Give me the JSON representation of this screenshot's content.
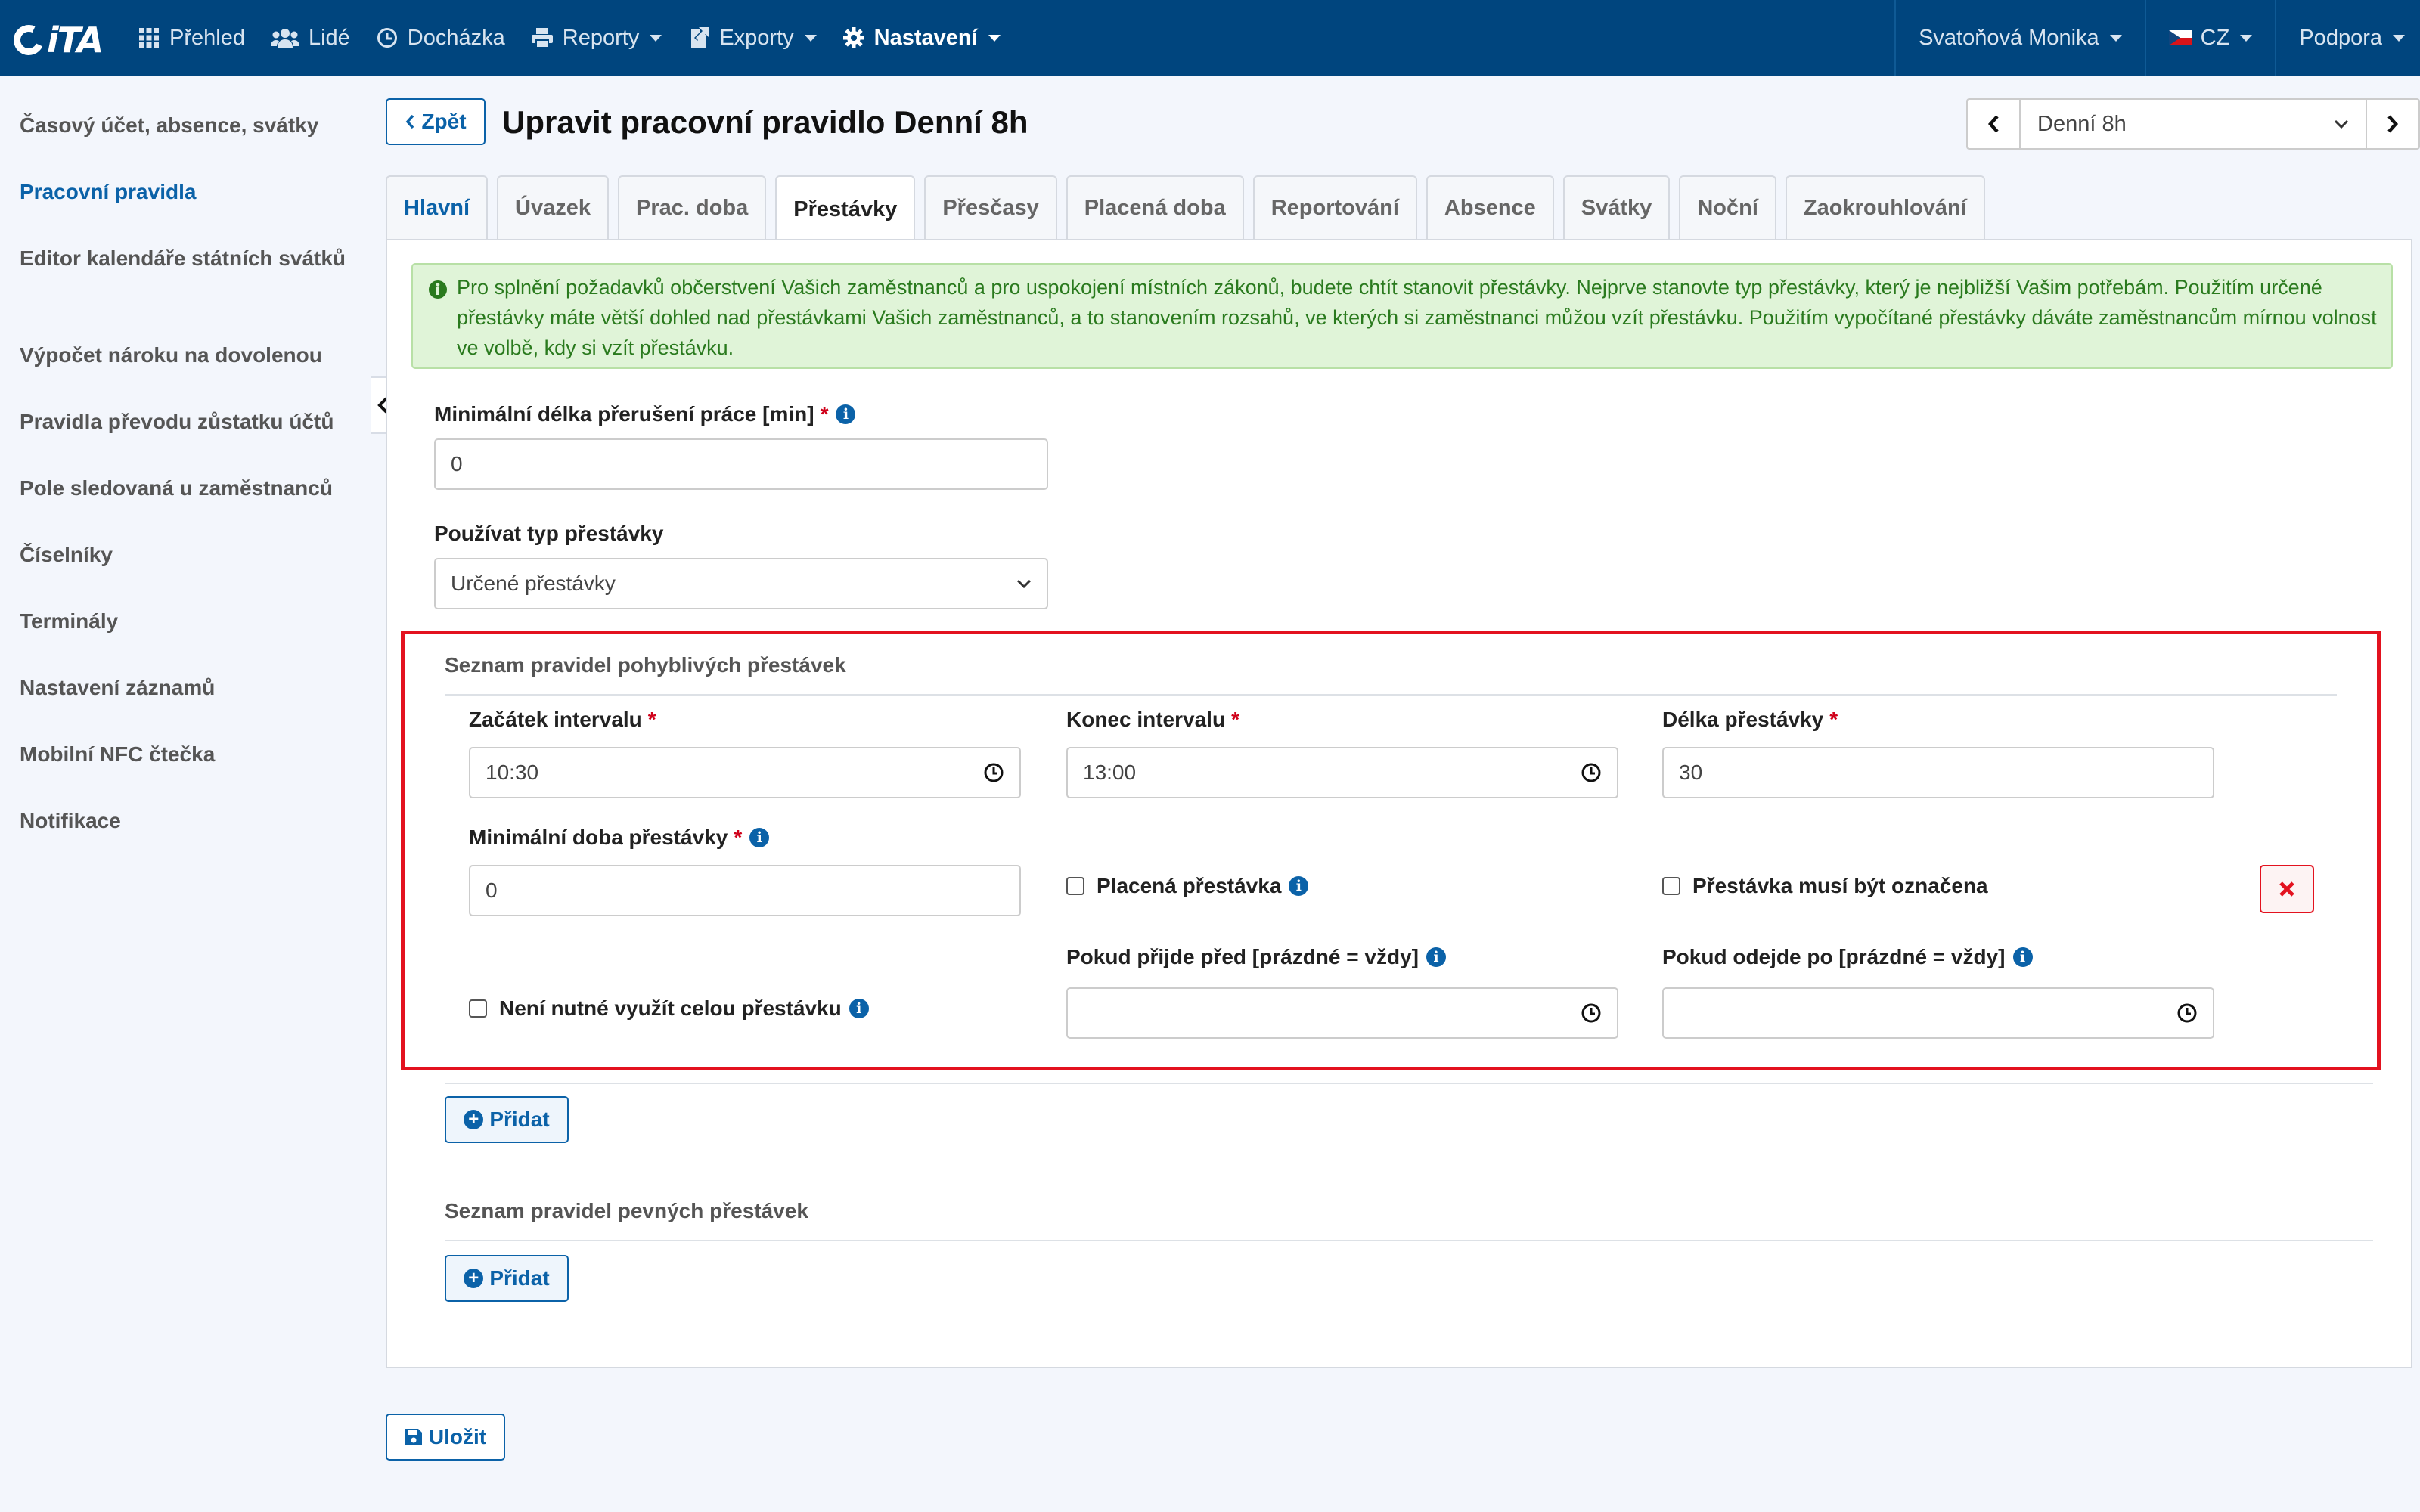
{
  "app": {
    "logo": "iTA"
  },
  "nav": {
    "items": [
      {
        "label": "Přehled",
        "icon": "grid-icon"
      },
      {
        "label": "Lidé",
        "icon": "users-icon"
      },
      {
        "label": "Docházka",
        "icon": "clock-icon"
      },
      {
        "label": "Reporty",
        "icon": "print-icon"
      },
      {
        "label": "Exporty",
        "icon": "export-icon"
      },
      {
        "label": "Nastavení",
        "icon": "gear-icon"
      }
    ],
    "user": "Svatoňová Monika",
    "language": "CZ",
    "support": "Podpora"
  },
  "sidebar": {
    "items": [
      {
        "label": "Časový účet, absence, svátky"
      },
      {
        "label": "Pracovní pravidla",
        "active": true
      },
      {
        "label": "Editor kalendáře státních svátků"
      },
      {
        "label": "Výpočet nároku na dovolenou"
      },
      {
        "label": "Pravidla převodu zůstatku účtů"
      },
      {
        "label": "Pole sledovaná u zaměstnanců"
      },
      {
        "label": "Číselníky"
      },
      {
        "label": "Terminály"
      },
      {
        "label": "Nastavení záznamů"
      },
      {
        "label": "Mobilní NFC čtečka"
      },
      {
        "label": "Notifikace"
      }
    ]
  },
  "header": {
    "back_label": "Zpět",
    "title": "Upravit pracovní pravidlo Denní 8h",
    "rule_select": "Denní 8h"
  },
  "tabs": [
    {
      "label": "Hlavní"
    },
    {
      "label": "Úvazek"
    },
    {
      "label": "Prac. doba"
    },
    {
      "label": "Přestávky",
      "active": true
    },
    {
      "label": "Přesčasy"
    },
    {
      "label": "Placená doba"
    },
    {
      "label": "Reportování"
    },
    {
      "label": "Absence"
    },
    {
      "label": "Svátky"
    },
    {
      "label": "Noční"
    },
    {
      "label": "Zaokrouhlování"
    }
  ],
  "alert": {
    "text": "Pro splnění požadavků občerstvení Vašich zaměstnanců a pro uspokojení místních zákonů, budete chtít stanovit přestávky. Nejprve stanovte typ přestávky, který je nejbližší Vašim potřebám. Použitím určené přestávky máte větší dohled nad přestávkami Vašich zaměstnanců, a to stanovením rozsahů, ve kterých si zaměstnanci můžou vzít přestávku. Použitím vypočítané přestávky dáváte zaměstnancům mírnou volnost ve volbě, kdy si vzít přestávku."
  },
  "form": {
    "min_break_label": "Minimální délka přerušení práce [min]",
    "min_break_value": "0",
    "break_type_label": "Používat typ přestávky",
    "break_type_value": "Určené přestávky",
    "flexible": {
      "title": "Seznam pravidel pohyblivých přestávek",
      "start_label": "Začátek intervalu",
      "start_value": "10:30",
      "end_label": "Konec intervalu",
      "end_value": "13:00",
      "length_label": "Délka přestávky",
      "length_value": "30",
      "min_duration_label": "Minimální doba přestávky",
      "min_duration_value": "0",
      "paid_label": "Placená přestávka",
      "must_mark_label": "Přestávka musí být označena",
      "arrive_before_label": "Pokud přijde před [prázdné = vždy]",
      "arrive_before_value": "",
      "leave_after_label": "Pokud odejde po [prázdné = vždy]",
      "leave_after_value": "",
      "not_full_label": "Není nutné využít celou přestávku",
      "add_label": "Přidat"
    },
    "fixed": {
      "title": "Seznam pravidel pevných přestávek",
      "add_label": "Přidat"
    },
    "save_label": "Uložit"
  },
  "colors": {
    "navbar": "#00457e",
    "accent": "#0b62a8",
    "highlight": "#e3121f",
    "alert_bg": "#e0f4d8"
  }
}
